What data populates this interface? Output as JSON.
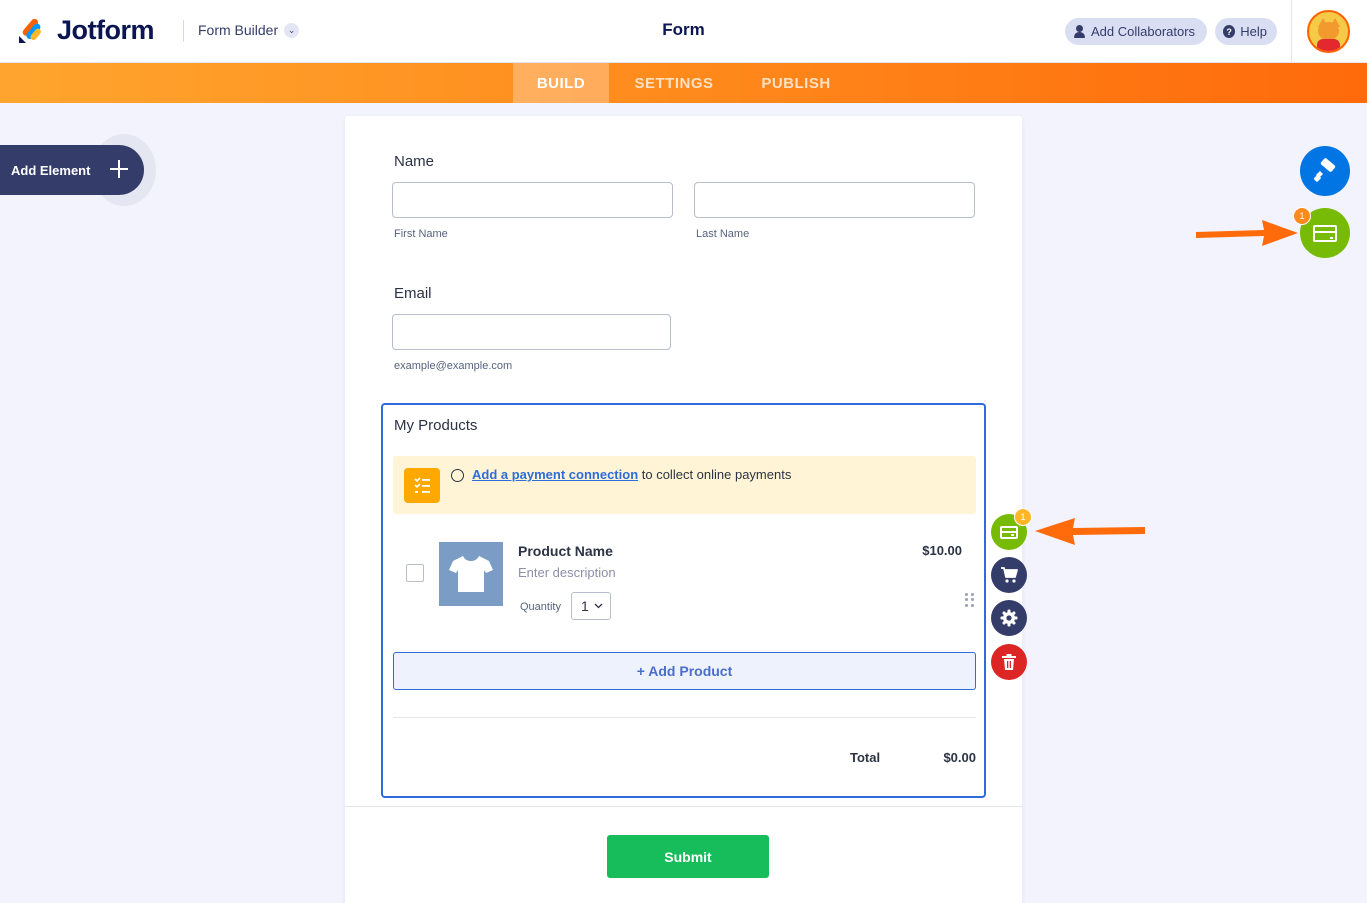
{
  "header": {
    "logo_text": "Jotform",
    "builder_menu": "Form Builder",
    "form_title": "Form",
    "add_collaborators": "Add Collaborators",
    "help": "Help"
  },
  "tabs": [
    {
      "label": "BUILD",
      "active": true
    },
    {
      "label": "SETTINGS",
      "active": false
    },
    {
      "label": "PUBLISH",
      "active": false
    }
  ],
  "add_element": "Add Element",
  "form": {
    "name": {
      "label": "Name",
      "first_sublabel": "First Name",
      "last_sublabel": "Last Name",
      "first_value": "",
      "last_value": ""
    },
    "email": {
      "label": "Email",
      "sublabel": "example@example.com",
      "value": ""
    },
    "products": {
      "label": "My Products",
      "notice_link": "Add a payment connection",
      "notice_text": " to collect online payments",
      "items": [
        {
          "name": "Product Name",
          "description": "Enter description",
          "quantity_label": "Quantity",
          "quantity": "1",
          "price": "$10.00",
          "checked": false
        }
      ],
      "add_product": "+ Add Product",
      "total_label": "Total",
      "total_value": "$0.00"
    },
    "submit": "Submit"
  },
  "side_tools": {
    "payment_badge": "1",
    "icons": [
      "payment-card-icon",
      "cart-icon",
      "gear-icon",
      "trash-icon"
    ]
  },
  "right_fabs": {
    "payment_badge": "1",
    "icons": [
      "paint-roller-icon",
      "payment-card-icon"
    ]
  },
  "colors": {
    "accent_orange": "#ff6100",
    "brand_navy": "#0a1551",
    "selection_blue": "#2e6bdb",
    "submit_green": "#18bd5b",
    "payment_green": "#78bb07",
    "delete_red": "#dc2626",
    "notice_bg": "#fff5d6"
  }
}
